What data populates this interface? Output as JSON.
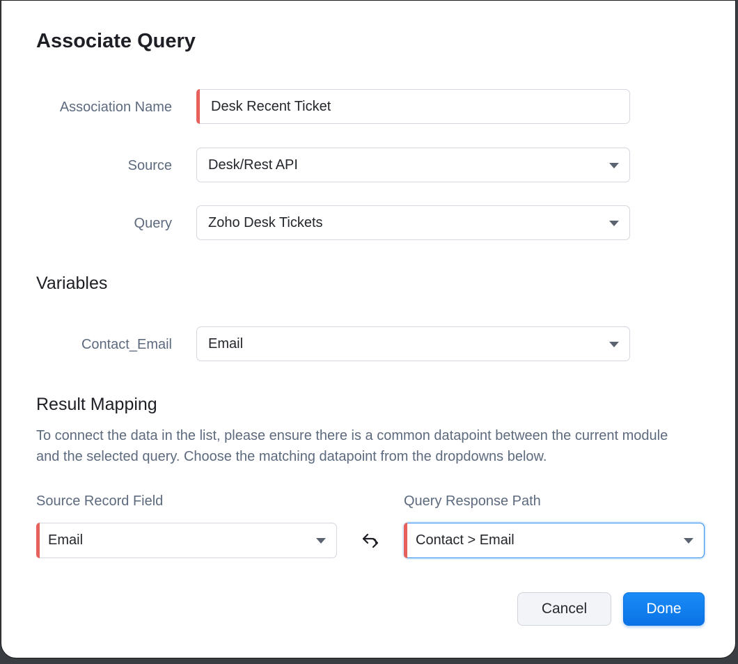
{
  "dialog": {
    "title": "Associate Query"
  },
  "form": {
    "association_name": {
      "label": "Association Name",
      "value": "Desk Recent Ticket"
    },
    "source": {
      "label": "Source",
      "value": "Desk/Rest API"
    },
    "query": {
      "label": "Query",
      "value": "Zoho Desk Tickets"
    }
  },
  "variables": {
    "title": "Variables",
    "contact_email": {
      "label": "Contact_Email",
      "value": "Email"
    }
  },
  "result_mapping": {
    "title": "Result Mapping",
    "description": "To connect the data in the list, please ensure there is a common datapoint between the current module and the selected query. Choose the matching datapoint from the dropdowns below.",
    "source_record_field": {
      "label": "Source Record Field",
      "value": "Email"
    },
    "query_response_path": {
      "label": "Query Response Path",
      "value": "Contact > Email"
    }
  },
  "buttons": {
    "cancel": "Cancel",
    "done": "Done"
  },
  "colors": {
    "accent": "#0a73e6",
    "required_marker": "#e8605b",
    "label": "#5d6a7e"
  },
  "icons": {
    "dropdown": "chevron-down-icon",
    "swap": "swap-arrows-icon"
  }
}
